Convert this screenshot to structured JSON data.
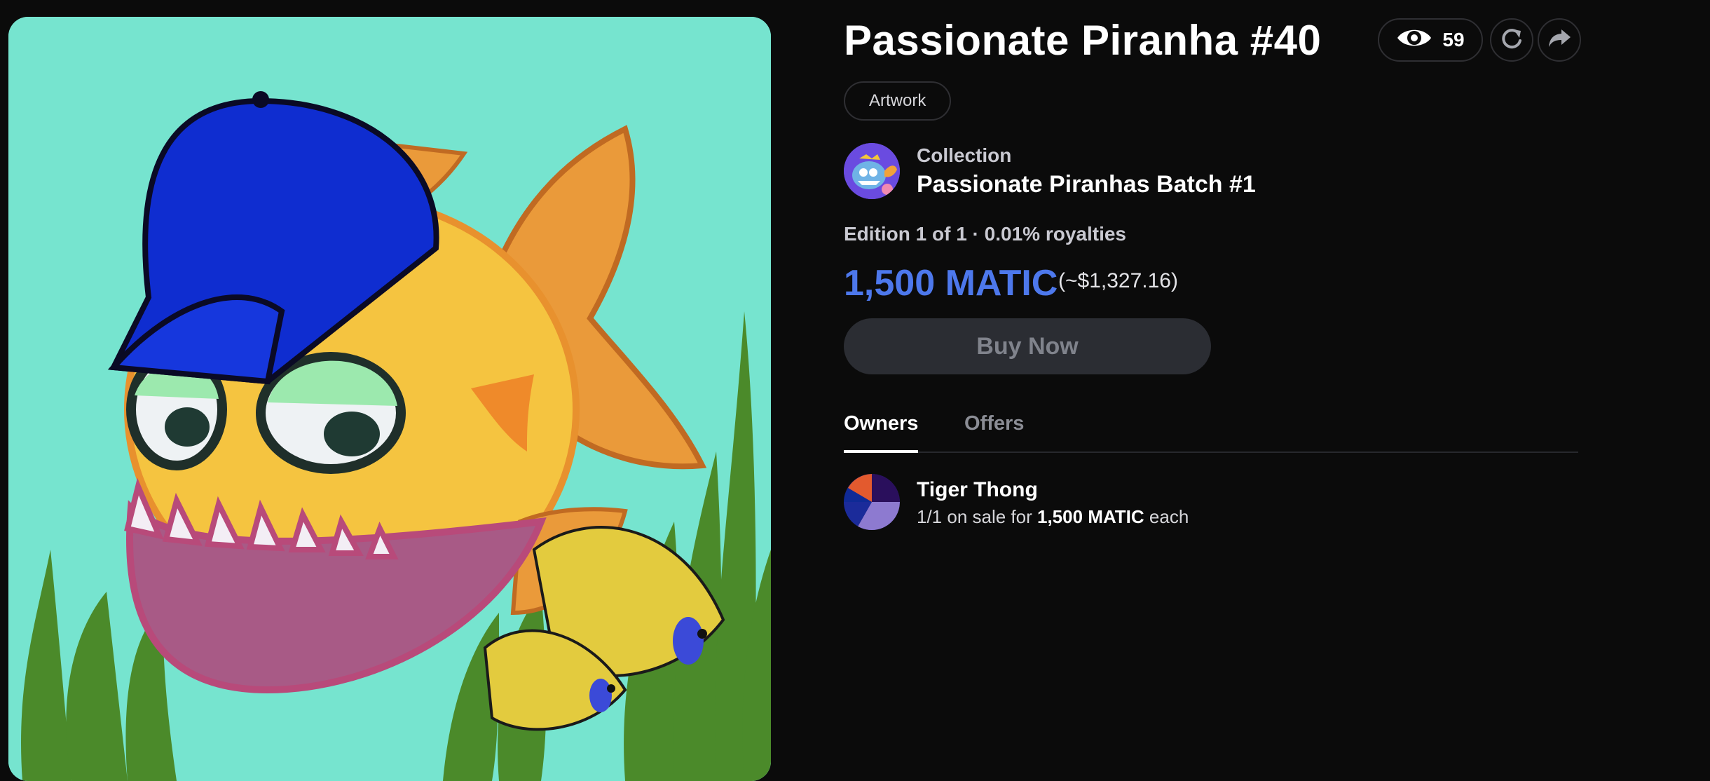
{
  "item": {
    "title": "Passionate Piranha #40",
    "views": "59",
    "tag": "Artwork"
  },
  "collection": {
    "label": "Collection",
    "name": "Passionate Piranhas Batch #1"
  },
  "edition_text": "Edition 1 of 1 · 0.01% royalties",
  "price": {
    "amount": "1,500 MATIC",
    "usd": "(~$1,327.16)"
  },
  "buy_button_label": "Buy Now",
  "tabs": [
    {
      "label": "Owners",
      "active": true
    },
    {
      "label": "Offers",
      "active": false
    }
  ],
  "owner": {
    "name": "Tiger Thong",
    "sale_prefix": "1/1 on sale for ",
    "sale_amount": "1,500 MATIC",
    "sale_suffix": " each"
  },
  "icons": {
    "views": "eye-icon",
    "refresh": "refresh-icon",
    "share": "share-icon"
  },
  "colors": {
    "accent_price": "#4d78ec",
    "artwork_background": "#76e4cf",
    "page_background": "#0b0b0b"
  }
}
